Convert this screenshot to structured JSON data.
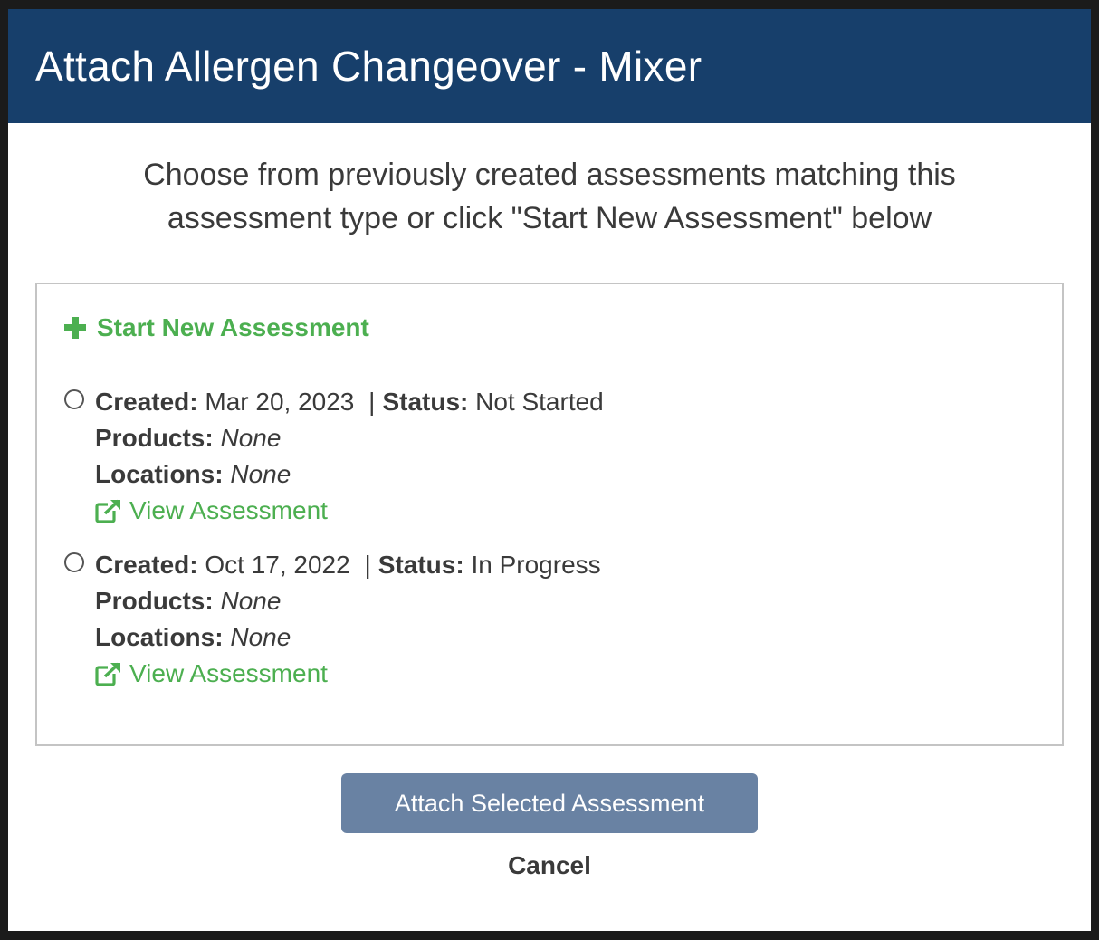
{
  "modal": {
    "title": "Attach Allergen Changeover - Mixer",
    "intro": "Choose from previously created assessments matching this assessment type or click \"Start New Assessment\" below",
    "start_new_label": "Start New Assessment",
    "assessments": [
      {
        "created_label": "Created:",
        "created_value": "Mar 20, 2023",
        "separator": "|",
        "status_label": "Status:",
        "status_value": "Not Started",
        "products_label": "Products:",
        "products_value": "None",
        "locations_label": "Locations:",
        "locations_value": "None",
        "view_label": "View Assessment",
        "selected": false
      },
      {
        "created_label": "Created:",
        "created_value": "Oct 17, 2022",
        "separator": "|",
        "status_label": "Status:",
        "status_value": "In Progress",
        "products_label": "Products:",
        "products_value": "None",
        "locations_label": "Locations:",
        "locations_value": "None",
        "view_label": "View Assessment",
        "selected": false
      }
    ],
    "attach_button_label": "Attach Selected Assessment",
    "cancel_label": "Cancel"
  },
  "colors": {
    "header_bg": "#173f6b",
    "accent_green": "#4caf50",
    "button_bg": "#6982a3"
  },
  "icons": {
    "start_new": "plus-icon",
    "view": "external-link-icon",
    "radio": "radio-unchecked"
  }
}
